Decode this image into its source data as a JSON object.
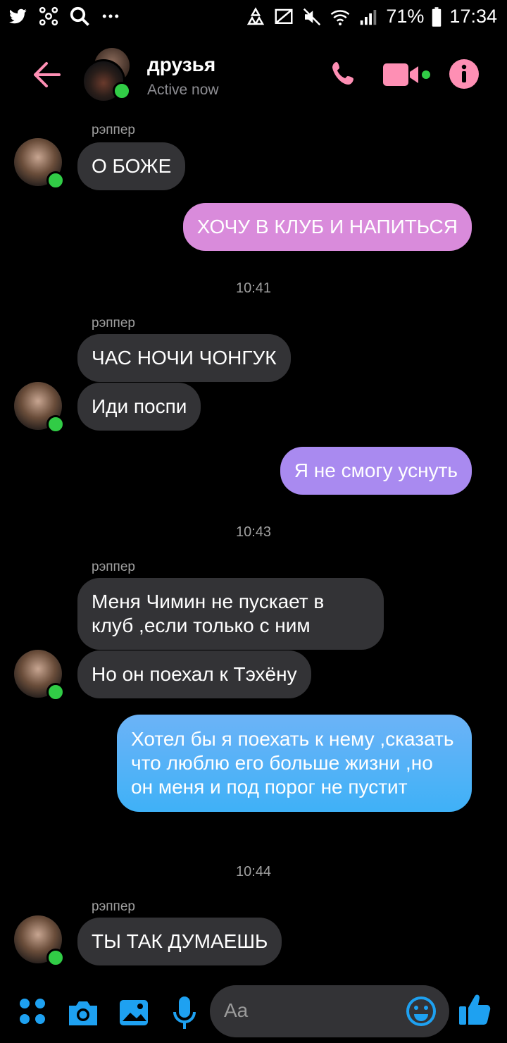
{
  "status_bar": {
    "battery": "71%",
    "time": "17:34"
  },
  "header": {
    "title": "друзья",
    "subtitle": "Active now"
  },
  "messages": {
    "sender_1": "рэппер",
    "m1": "О БОЖЕ",
    "m2": "ХОЧУ В КЛУБ И НАПИТЬСЯ",
    "time_1": "10:41",
    "sender_2": "рэппер",
    "m3": "ЧАС НОЧИ ЧОНГУК",
    "m4": "Иди поспи",
    "m5": "Я не смогу уснуть",
    "time_2": "10:43",
    "sender_3": "рэппер",
    "m6": "Меня Чимин не пускает в клуб ,если только с ним",
    "m7": "Но он поехал к Тэхёну",
    "m8": "Хотел бы я поехать к нему ,сказать что люблю его больше жизни ,но он меня и под порог не пустит",
    "time_3": "10:44",
    "sender_4": "рэппер",
    "m9": "ТЫ ТАК ДУМАЕШЬ"
  },
  "composer": {
    "placeholder": "Aa"
  },
  "colors": {
    "accent_pink": "#fe8fb4",
    "online_green": "#31cc46",
    "incoming_bubble": "#333336",
    "outgoing_pink": "#d98bdb",
    "outgoing_purple": "#a98af0",
    "outgoing_blue": "#56b3f7",
    "composer_blue": "#1ea1f1"
  }
}
